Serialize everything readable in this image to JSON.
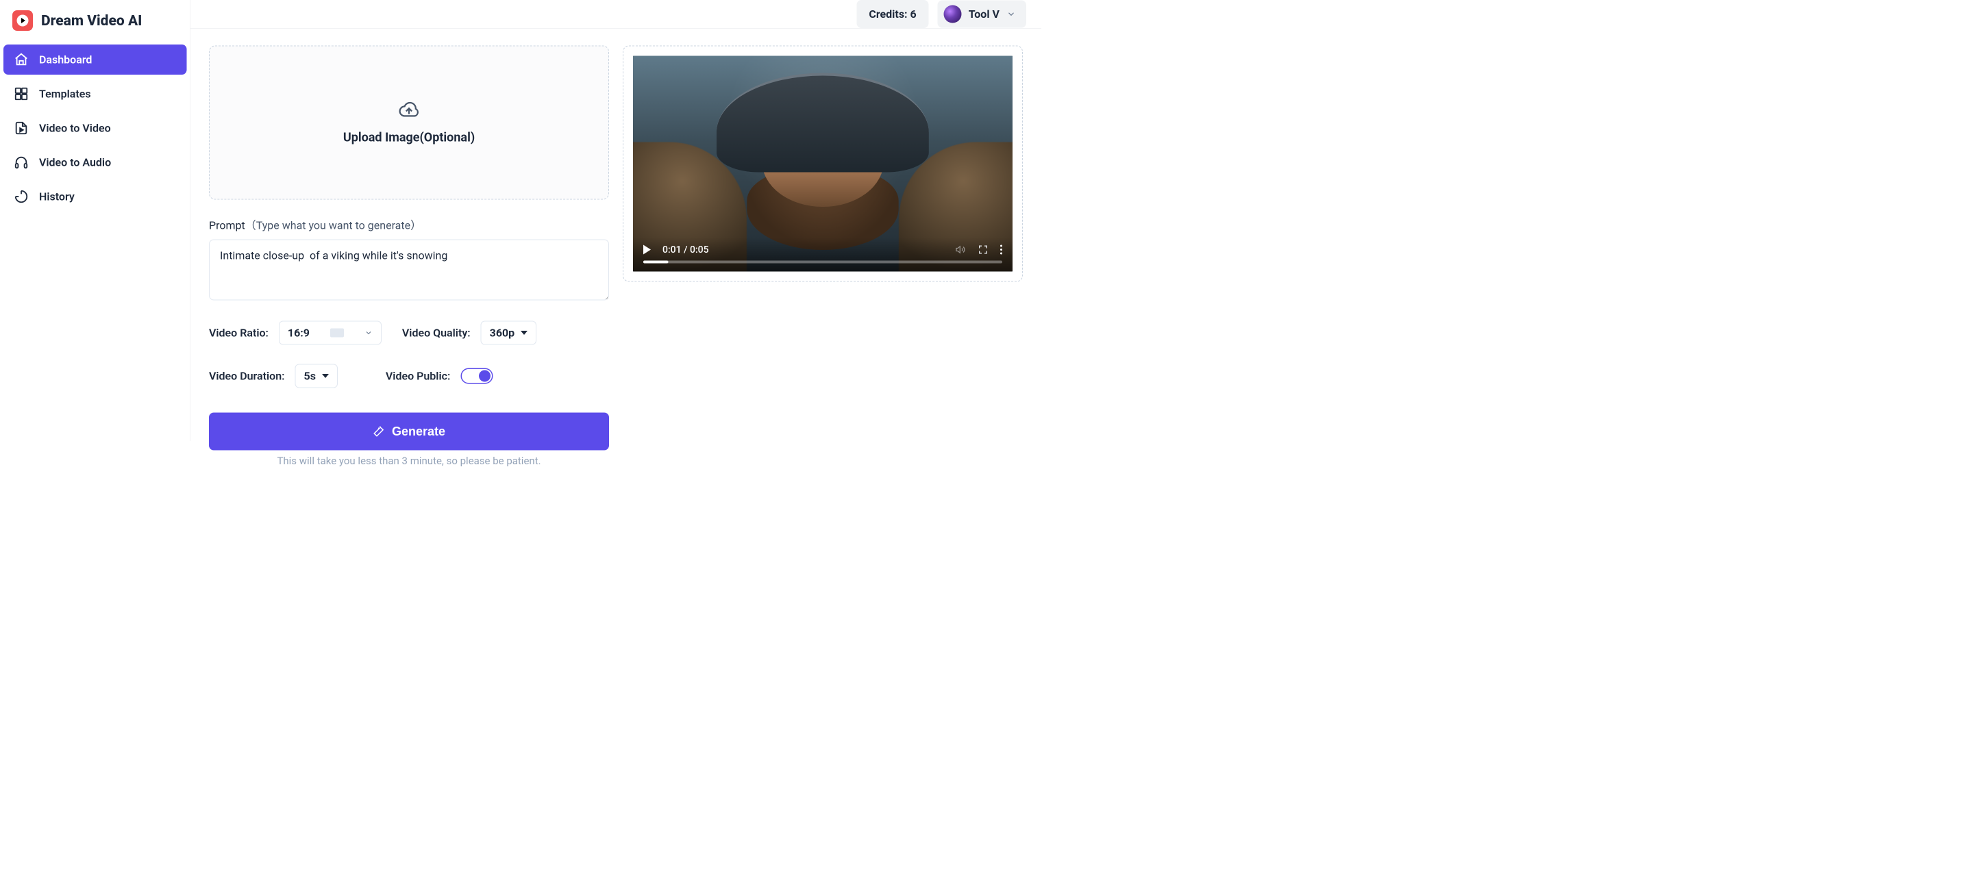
{
  "app": {
    "name": "Dream Video AI"
  },
  "header": {
    "credits_label": "Credits: 6",
    "user_name": "Tool V"
  },
  "sidebar": {
    "items": [
      {
        "label": "Dashboard",
        "active": true
      },
      {
        "label": "Templates",
        "active": false
      },
      {
        "label": "Video to Video",
        "active": false
      },
      {
        "label": "Video to Audio",
        "active": false
      },
      {
        "label": "History",
        "active": false
      }
    ]
  },
  "upload": {
    "label": "Upload Image(Optional)"
  },
  "prompt": {
    "label": "Prompt",
    "hint": "（Type what you want to generate）",
    "value": "Intimate close-up  of a viking while it's snowing"
  },
  "controls": {
    "ratio_label": "Video Ratio:",
    "ratio_value": "16:9",
    "quality_label": "Video Quality:",
    "quality_value": "360p",
    "duration_label": "Video Duration:",
    "duration_value": "5s",
    "public_label": "Video Public:",
    "public_on": true
  },
  "generate": {
    "button": "Generate",
    "note": "This will take you less than 3 minute, so please be patient."
  },
  "player": {
    "time": "0:01 / 0:05",
    "progress_pct": 7
  },
  "colors": {
    "accent": "#5b4bea"
  }
}
